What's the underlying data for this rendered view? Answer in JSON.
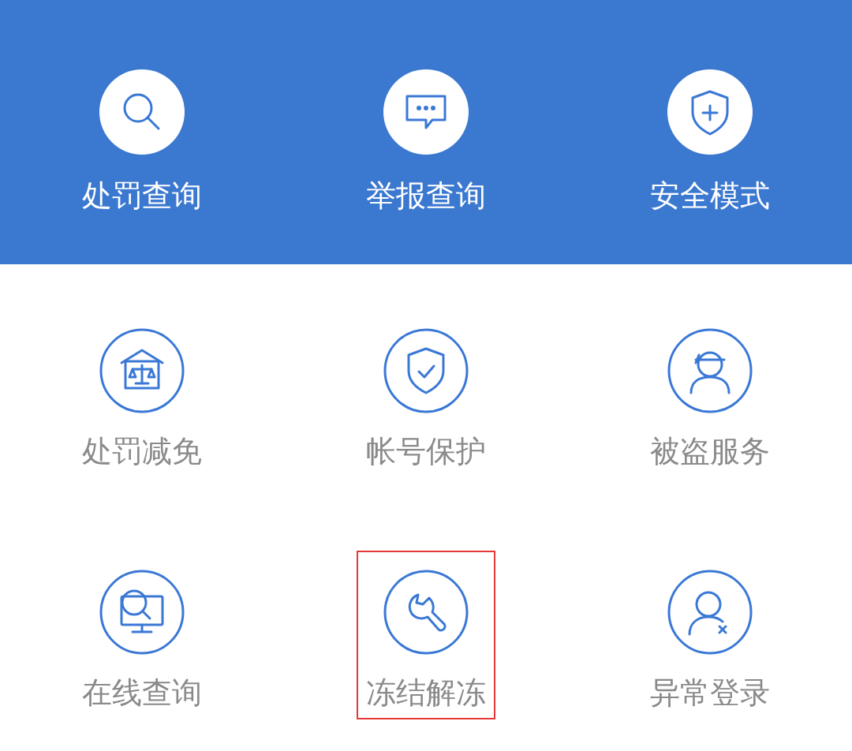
{
  "top_actions": [
    {
      "label": "处罚查询",
      "kind": "search"
    },
    {
      "label": "举报查询",
      "kind": "chat"
    },
    {
      "label": "安全模式",
      "kind": "shield-plus"
    }
  ],
  "services": [
    {
      "label": "处罚减免",
      "kind": "court",
      "highlighted": false
    },
    {
      "label": "帐号保护",
      "kind": "shield-check",
      "highlighted": false
    },
    {
      "label": "被盗服务",
      "kind": "person-mask",
      "highlighted": false
    },
    {
      "label": "在线查询",
      "kind": "monitor-search",
      "highlighted": false
    },
    {
      "label": "冻结解冻",
      "kind": "wrench",
      "highlighted": true
    },
    {
      "label": "异常登录",
      "kind": "person-x",
      "highlighted": false
    }
  ]
}
